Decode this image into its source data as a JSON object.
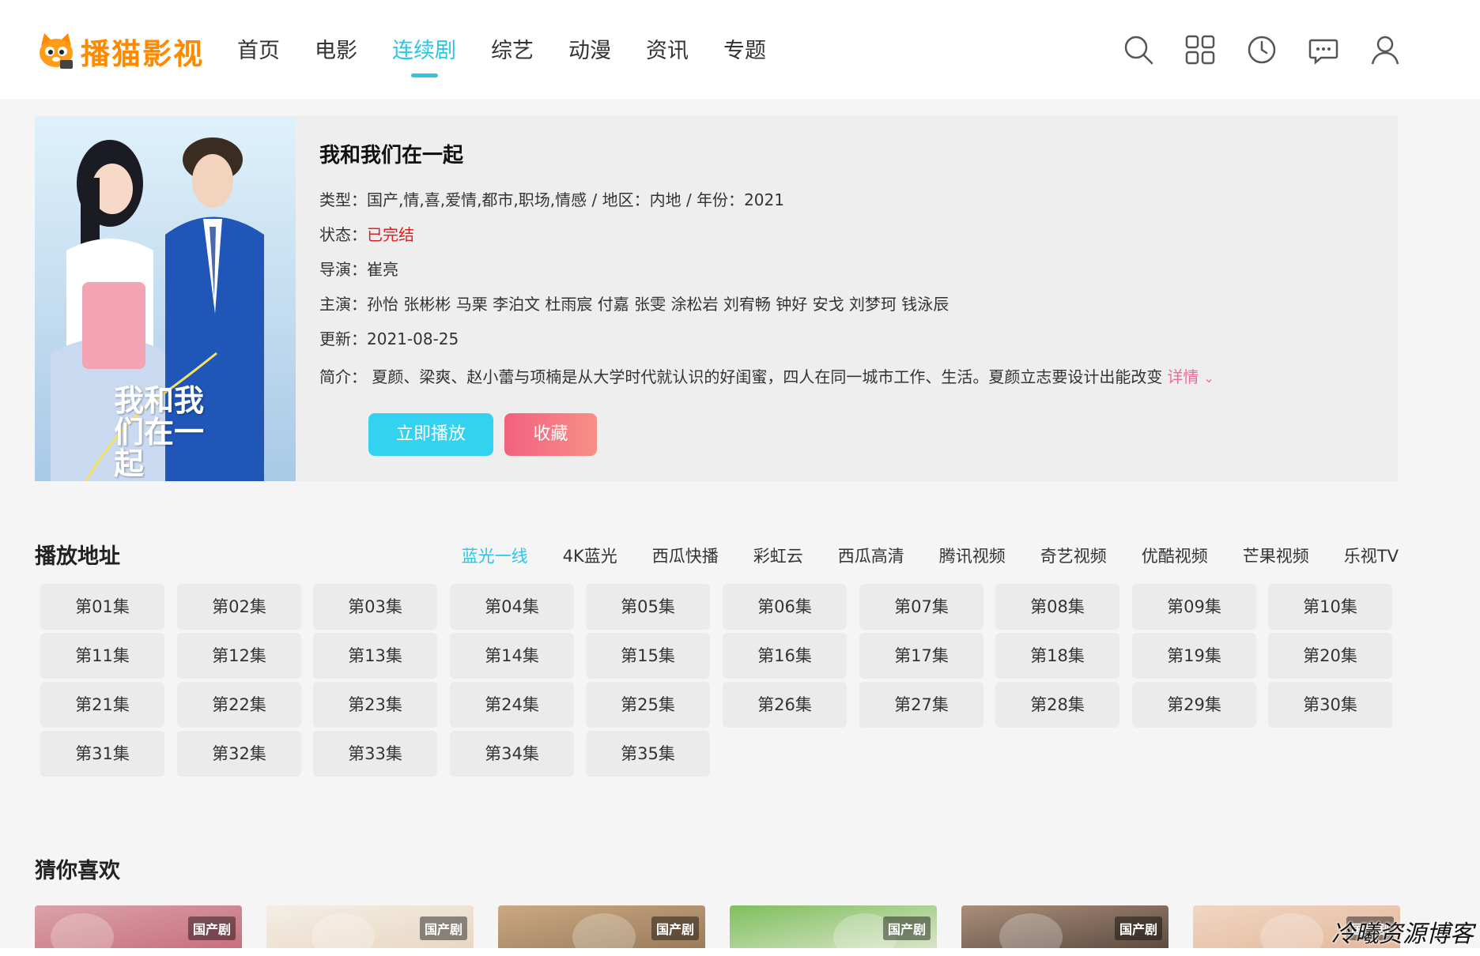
{
  "header": {
    "logo_text": "播猫影视",
    "nav": [
      "首页",
      "电影",
      "连续剧",
      "综艺",
      "动漫",
      "资讯",
      "专题"
    ],
    "active_nav": "连续剧",
    "icons": [
      "search-icon",
      "category-grid-icon",
      "history-clock-icon",
      "message-icon",
      "user-icon"
    ]
  },
  "detail": {
    "poster_text": "我和我们在一起",
    "title": "我和我们在一起",
    "type_label": "类型：",
    "type_value": "国产,情,喜,爱情,都市,职场,情感",
    "sep1": " / ",
    "region_label": "地区：",
    "region_value": "内地",
    "sep2": " / ",
    "year_label": "年份：",
    "year_value": "2021",
    "status_label": "状态：",
    "status_value": "已完结",
    "director_label": "导演：",
    "director_value": "崔亮",
    "cast_label": "主演：",
    "cast_value": "孙怡 张彬彬 马栗 李泊文 杜雨宸 付嘉 张雯 涂松岩 刘宥畅 钟好 安戈 刘梦珂 钱泳辰",
    "update_label": "更新：",
    "update_value": "2021-08-25",
    "desc_label": "简介：",
    "desc_value": "夏颜、梁爽、赵小蕾与项楠是从大学时代就认识的好闺蜜，四人在同一城市工作、生活。夏颜立志要设计出能改变",
    "desc_more": "详情",
    "play_button": "立即播放",
    "favorite_button": "收藏"
  },
  "play": {
    "title": "播放地址",
    "sources": [
      "蓝光一线",
      "4K蓝光",
      "西瓜快播",
      "彩虹云",
      "西瓜高清",
      "腾讯视频",
      "奇艺视频",
      "优酷视频",
      "芒果视频",
      "乐视TV"
    ],
    "active_source": "蓝光一线",
    "episodes": [
      "第01集",
      "第02集",
      "第03集",
      "第04集",
      "第05集",
      "第06集",
      "第07集",
      "第08集",
      "第09集",
      "第10集",
      "第11集",
      "第12集",
      "第13集",
      "第14集",
      "第15集",
      "第16集",
      "第17集",
      "第18集",
      "第19集",
      "第20集",
      "第21集",
      "第22集",
      "第23集",
      "第24集",
      "第25集",
      "第26集",
      "第27集",
      "第28集",
      "第29集",
      "第30集",
      "第31集",
      "第32集",
      "第33集",
      "第34集",
      "第35集"
    ]
  },
  "recommend": {
    "title": "猜你喜欢",
    "cards": [
      {
        "badge": "国产剧",
        "c1": "#d9a2a8",
        "c2": "#c86f7e"
      },
      {
        "badge": "国产剧",
        "c1": "#f3eee4",
        "c2": "#e9d7c4"
      },
      {
        "badge": "国产剧",
        "c1": "#caa981",
        "c2": "#9a7b5c"
      },
      {
        "badge": "国产剧",
        "c1": "#7fbf5e",
        "c2": "#d9e4c8"
      },
      {
        "badge": "国产剧",
        "c1": "#a98e7b",
        "c2": "#5e4b40"
      },
      {
        "badge": "国产剧",
        "c1": "#f0d6c2",
        "c2": "#e3b89d"
      }
    ]
  },
  "watermark": "冷曦资源博客",
  "colors": {
    "accent": "#29c6e9",
    "status_red": "#e02020",
    "link_pink": "#f0689a",
    "play_button": "#33d2f0",
    "favorite_button_start": "#f2617f",
    "favorite_button_end": "#f88f86",
    "logo_orange": "#ff8a00"
  }
}
